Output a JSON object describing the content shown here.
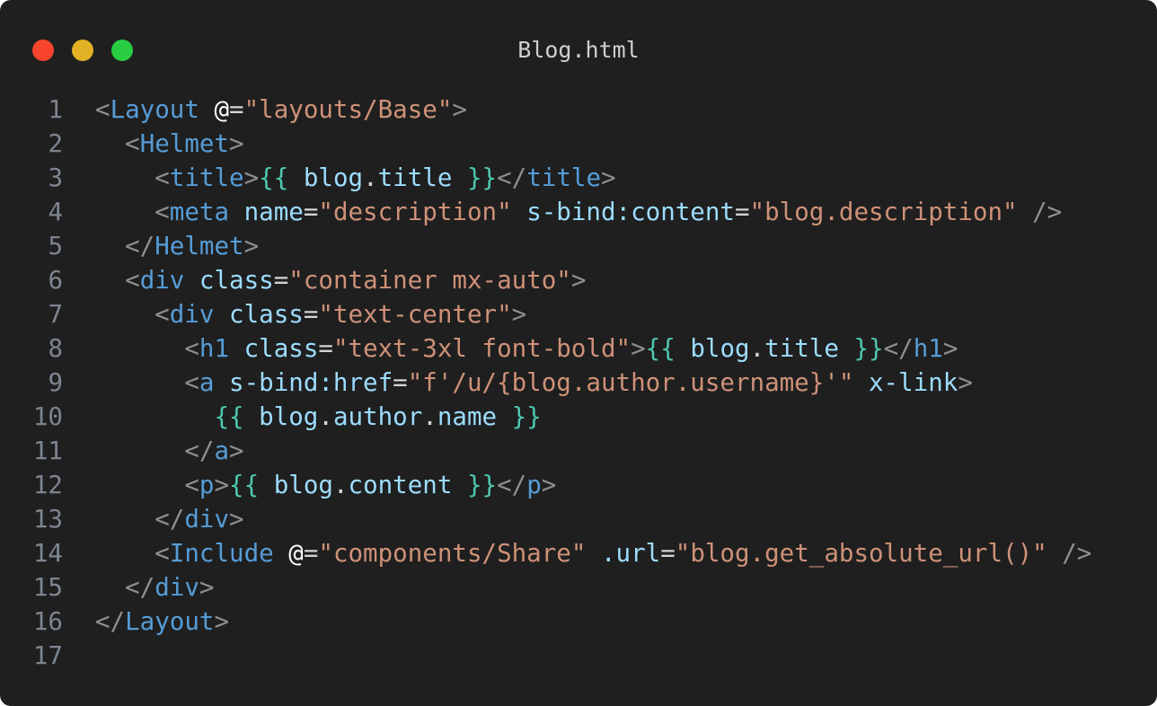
{
  "window": {
    "title": "Blog.html"
  },
  "colors": {
    "background": "#1f1f1f",
    "close": "#f8442d",
    "minimize": "#e2b125",
    "maximize": "#28cd42",
    "punctuation": "#8f8f8f",
    "tag": "#569cd6",
    "attribute": "#9cdcfe",
    "string": "#ce9178",
    "brace": "#4ec9b0",
    "line_number": "#7d8590"
  },
  "lines": [
    {
      "n": "1",
      "tokens": [
        [
          "p",
          "<"
        ],
        [
          "t",
          "Layout"
        ],
        [
          "o",
          " "
        ],
        [
          "m",
          "@"
        ],
        [
          "o",
          "="
        ],
        [
          "s",
          "\"layouts/Base\""
        ],
        [
          "p",
          ">"
        ]
      ]
    },
    {
      "n": "2",
      "tokens": [
        [
          "o",
          "  "
        ],
        [
          "p",
          "<"
        ],
        [
          "t",
          "Helmet"
        ],
        [
          "p",
          ">"
        ]
      ]
    },
    {
      "n": "3",
      "tokens": [
        [
          "o",
          "    "
        ],
        [
          "p",
          "<"
        ],
        [
          "t",
          "title"
        ],
        [
          "p",
          ">"
        ],
        [
          "b",
          "{{"
        ],
        [
          "o",
          " "
        ],
        [
          "v",
          "blog"
        ],
        [
          "o",
          "."
        ],
        [
          "v",
          "title"
        ],
        [
          "o",
          " "
        ],
        [
          "b",
          "}}"
        ],
        [
          "p",
          "</"
        ],
        [
          "t",
          "title"
        ],
        [
          "p",
          ">"
        ]
      ]
    },
    {
      "n": "4",
      "tokens": [
        [
          "o",
          "    "
        ],
        [
          "p",
          "<"
        ],
        [
          "t",
          "meta"
        ],
        [
          "o",
          " "
        ],
        [
          "a",
          "name"
        ],
        [
          "o",
          "="
        ],
        [
          "s",
          "\"description\""
        ],
        [
          "o",
          " "
        ],
        [
          "a",
          "s-bind:content"
        ],
        [
          "o",
          "="
        ],
        [
          "s",
          "\"blog.description\""
        ],
        [
          "o",
          " "
        ],
        [
          "p",
          "/>"
        ]
      ]
    },
    {
      "n": "5",
      "tokens": [
        [
          "o",
          "  "
        ],
        [
          "p",
          "</"
        ],
        [
          "t",
          "Helmet"
        ],
        [
          "p",
          ">"
        ]
      ]
    },
    {
      "n": "6",
      "tokens": [
        [
          "o",
          "  "
        ],
        [
          "p",
          "<"
        ],
        [
          "t",
          "div"
        ],
        [
          "o",
          " "
        ],
        [
          "a",
          "class"
        ],
        [
          "o",
          "="
        ],
        [
          "s",
          "\"container mx-auto\""
        ],
        [
          "p",
          ">"
        ]
      ]
    },
    {
      "n": "7",
      "tokens": [
        [
          "o",
          "    "
        ],
        [
          "p",
          "<"
        ],
        [
          "t",
          "div"
        ],
        [
          "o",
          " "
        ],
        [
          "a",
          "class"
        ],
        [
          "o",
          "="
        ],
        [
          "s",
          "\"text-center\""
        ],
        [
          "p",
          ">"
        ]
      ]
    },
    {
      "n": "8",
      "tokens": [
        [
          "o",
          "      "
        ],
        [
          "p",
          "<"
        ],
        [
          "t",
          "h1"
        ],
        [
          "o",
          " "
        ],
        [
          "a",
          "class"
        ],
        [
          "o",
          "="
        ],
        [
          "s",
          "\"text-3xl font-bold\""
        ],
        [
          "p",
          ">"
        ],
        [
          "b",
          "{{"
        ],
        [
          "o",
          " "
        ],
        [
          "v",
          "blog"
        ],
        [
          "o",
          "."
        ],
        [
          "v",
          "title"
        ],
        [
          "o",
          " "
        ],
        [
          "b",
          "}}"
        ],
        [
          "p",
          "</"
        ],
        [
          "t",
          "h1"
        ],
        [
          "p",
          ">"
        ]
      ]
    },
    {
      "n": "9",
      "tokens": [
        [
          "o",
          "      "
        ],
        [
          "p",
          "<"
        ],
        [
          "t",
          "a"
        ],
        [
          "o",
          " "
        ],
        [
          "a",
          "s-bind:href"
        ],
        [
          "o",
          "="
        ],
        [
          "s",
          "\"f'/u/{blog.author.username}'\""
        ],
        [
          "o",
          " "
        ],
        [
          "a",
          "x-link"
        ],
        [
          "p",
          ">"
        ]
      ]
    },
    {
      "n": "10",
      "tokens": [
        [
          "o",
          "        "
        ],
        [
          "b",
          "{{"
        ],
        [
          "o",
          " "
        ],
        [
          "v",
          "blog"
        ],
        [
          "o",
          "."
        ],
        [
          "v",
          "author"
        ],
        [
          "o",
          "."
        ],
        [
          "v",
          "name"
        ],
        [
          "o",
          " "
        ],
        [
          "b",
          "}}"
        ]
      ]
    },
    {
      "n": "11",
      "tokens": [
        [
          "o",
          "      "
        ],
        [
          "p",
          "</"
        ],
        [
          "t",
          "a"
        ],
        [
          "p",
          ">"
        ]
      ]
    },
    {
      "n": "12",
      "tokens": [
        [
          "o",
          "      "
        ],
        [
          "p",
          "<"
        ],
        [
          "t",
          "p"
        ],
        [
          "p",
          ">"
        ],
        [
          "b",
          "{{"
        ],
        [
          "o",
          " "
        ],
        [
          "v",
          "blog"
        ],
        [
          "o",
          "."
        ],
        [
          "v",
          "content"
        ],
        [
          "o",
          " "
        ],
        [
          "b",
          "}}"
        ],
        [
          "p",
          "</"
        ],
        [
          "t",
          "p"
        ],
        [
          "p",
          ">"
        ]
      ]
    },
    {
      "n": "13",
      "tokens": [
        [
          "o",
          "    "
        ],
        [
          "p",
          "</"
        ],
        [
          "t",
          "div"
        ],
        [
          "p",
          ">"
        ]
      ]
    },
    {
      "n": "14",
      "tokens": [
        [
          "o",
          "    "
        ],
        [
          "p",
          "<"
        ],
        [
          "t",
          "Include"
        ],
        [
          "o",
          " "
        ],
        [
          "m",
          "@"
        ],
        [
          "o",
          "="
        ],
        [
          "s",
          "\"components/Share\""
        ],
        [
          "o",
          " "
        ],
        [
          "a",
          ".url"
        ],
        [
          "o",
          "="
        ],
        [
          "s",
          "\"blog.get_absolute_url()\""
        ],
        [
          "o",
          " "
        ],
        [
          "p",
          "/>"
        ]
      ]
    },
    {
      "n": "15",
      "tokens": [
        [
          "o",
          "  "
        ],
        [
          "p",
          "</"
        ],
        [
          "t",
          "div"
        ],
        [
          "p",
          ">"
        ]
      ]
    },
    {
      "n": "16",
      "tokens": [
        [
          "p",
          "</"
        ],
        [
          "t",
          "Layout"
        ],
        [
          "p",
          ">"
        ]
      ]
    },
    {
      "n": "17",
      "tokens": []
    }
  ]
}
